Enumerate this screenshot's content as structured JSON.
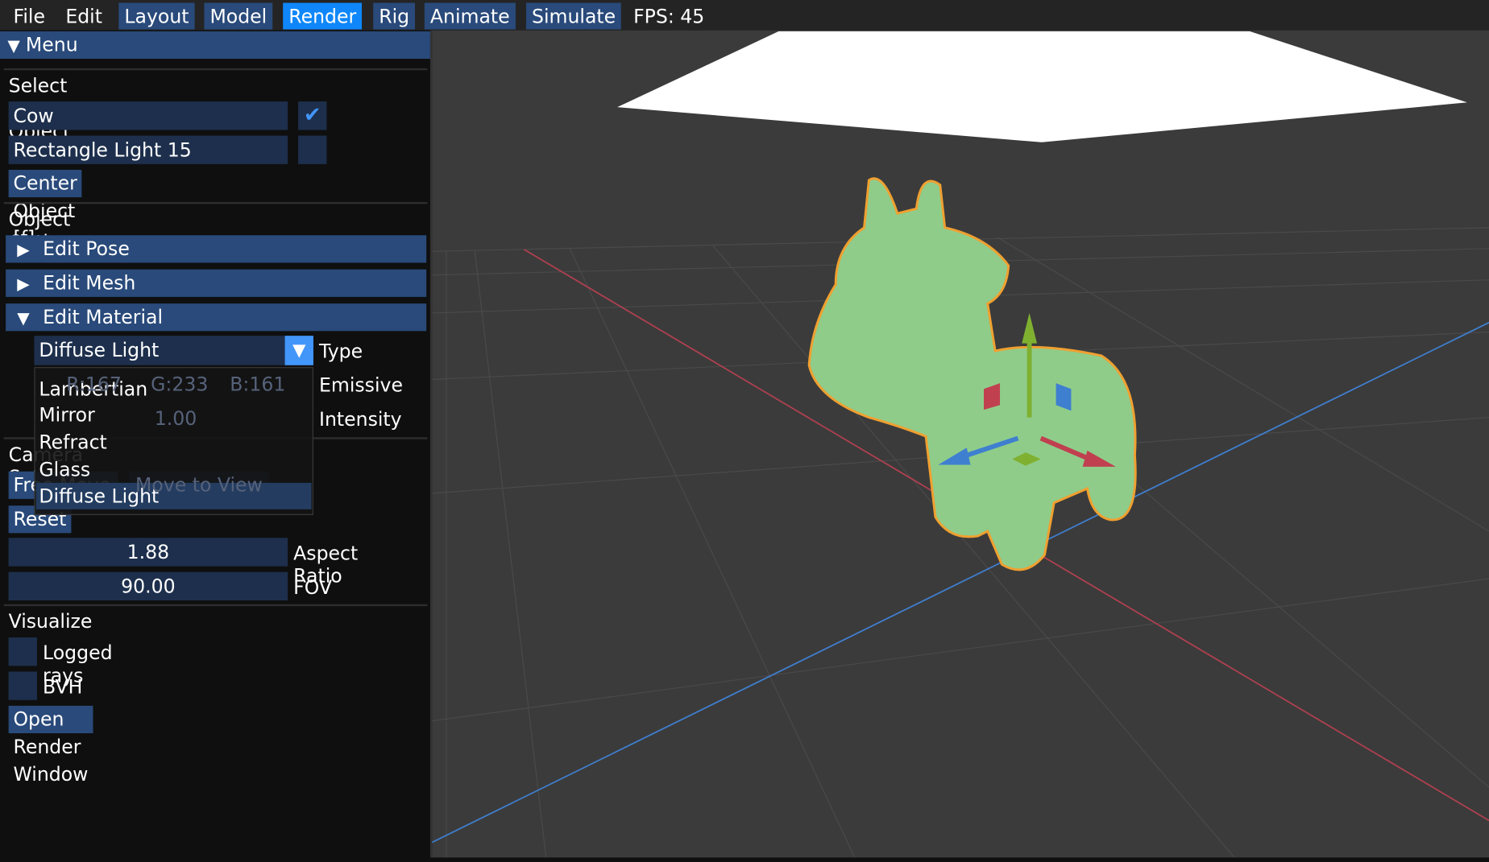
{
  "menubar": {
    "items": [
      "File",
      "Edit",
      "Layout",
      "Model",
      "Render",
      "Rig",
      "Animate",
      "Simulate"
    ],
    "active": "Render",
    "fps": "FPS: 45"
  },
  "panel": {
    "title": "Menu",
    "select_heading": "Select an Object",
    "objects": [
      {
        "name": "Cow",
        "checked": true
      },
      {
        "name": "Rectangle Light 15",
        "checked": false
      }
    ],
    "center_button": "Center Object [f]",
    "object_options_heading": "Object Options",
    "sections": [
      {
        "label": "Edit Pose",
        "expanded": false
      },
      {
        "label": "Edit Mesh",
        "expanded": false
      },
      {
        "label": "Edit Material",
        "expanded": true
      }
    ],
    "material": {
      "type_value": "Diffuse Light",
      "type_label": "Type",
      "emissive_label": "Emissive",
      "emissive_r": "R:167",
      "emissive_g": "G:233",
      "emissive_b": "B:161",
      "emissive_color": "#a7e9a1",
      "intensity_value": "1.00",
      "intensity_label": "Intensity",
      "options": [
        "Lambertian",
        "Mirror",
        "Refract",
        "Glass",
        "Diffuse Light"
      ],
      "selected_option": "Diffuse Light"
    },
    "camera": {
      "heading": "Camera Settings",
      "free_move": "Free Move",
      "move_to_view": "Move to View",
      "reset": "Reset",
      "aspect_value": "1.88",
      "aspect_label": "Aspect Ratio",
      "fov_value": "90.00",
      "fov_label": "FOV"
    },
    "visualize": {
      "heading": "Visualize",
      "options": [
        {
          "label": "Logged rays",
          "checked": false
        },
        {
          "label": "BVH",
          "checked": false
        }
      ],
      "open_render": "Open Render Window"
    }
  },
  "colors": {
    "accent": "#0f87fa",
    "header": "#294a7a",
    "field": "#1d2f4c",
    "mesh": "#8fcc8a",
    "outline": "#f0a030",
    "x_axis": "#c04050",
    "z_axis": "#3f7fd0"
  }
}
